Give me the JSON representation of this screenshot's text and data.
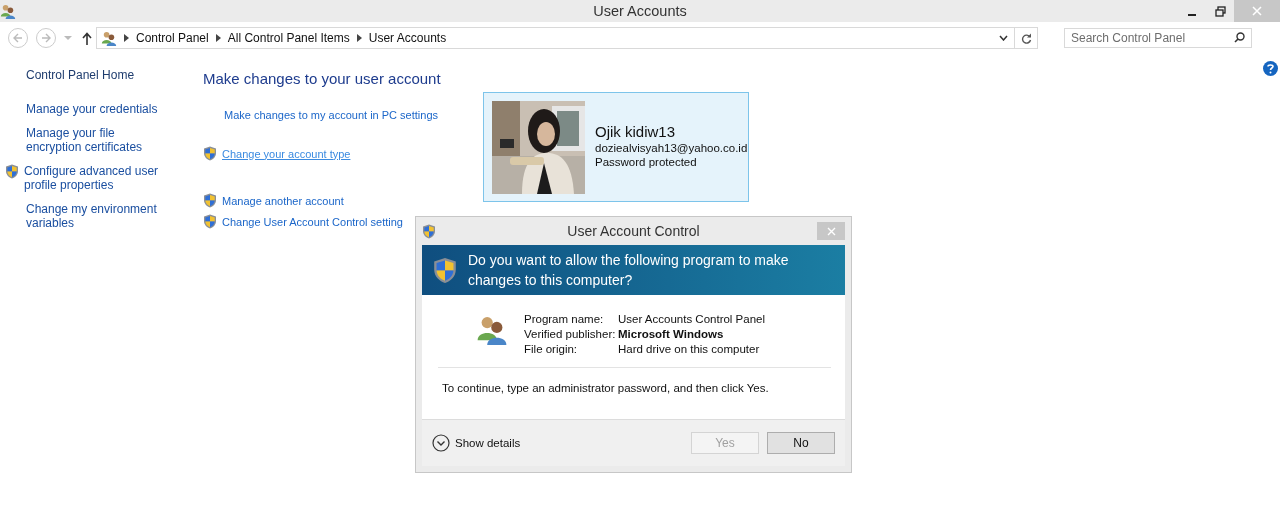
{
  "window": {
    "title": "User Accounts"
  },
  "breadcrumb": [
    "Control Panel",
    "All Control Panel Items",
    "User Accounts"
  ],
  "search": {
    "placeholder": "Search Control Panel"
  },
  "sidebar": {
    "items": [
      {
        "label": "Control Panel Home",
        "kind": "home"
      },
      {
        "label": "Manage your credentials",
        "kind": "plain"
      },
      {
        "label": "Manage your file encryption certificates",
        "kind": "plain"
      },
      {
        "label": "Configure advanced user profile properties",
        "kind": "shield"
      },
      {
        "label": "Change my environment variables",
        "kind": "plain"
      }
    ]
  },
  "main": {
    "heading": "Make changes to your user account",
    "task_groups": [
      [
        {
          "label": "Make changes to my account in PC settings",
          "kind": "plain",
          "hover": false
        },
        {
          "label": "Change your account type",
          "kind": "shield",
          "hover": true
        }
      ],
      [
        {
          "label": "Manage another account",
          "kind": "shield",
          "hover": false
        },
        {
          "label": "Change User Account Control setting",
          "kind": "shield",
          "hover": false
        }
      ]
    ]
  },
  "account": {
    "name": "Ojik kidiw13",
    "email": "doziealvisyah13@yahoo.co.id",
    "status": "Password protected"
  },
  "dialog": {
    "title": "User Account Control",
    "question": "Do you want to allow the following program to make changes to this computer?",
    "details": [
      {
        "label": "Program name:",
        "value": "User Accounts Control Panel",
        "bold": false
      },
      {
        "label": "Verified publisher:",
        "value": "Microsoft Windows",
        "bold": true
      },
      {
        "label": "File origin:",
        "value": "Hard drive on this computer",
        "bold": false
      }
    ],
    "instruction": "To continue, type an administrator password, and then click Yes.",
    "details_toggle": "Show details",
    "buttons": [
      {
        "label": "Yes",
        "disabled": true
      },
      {
        "label": "No",
        "disabled": false
      }
    ]
  }
}
